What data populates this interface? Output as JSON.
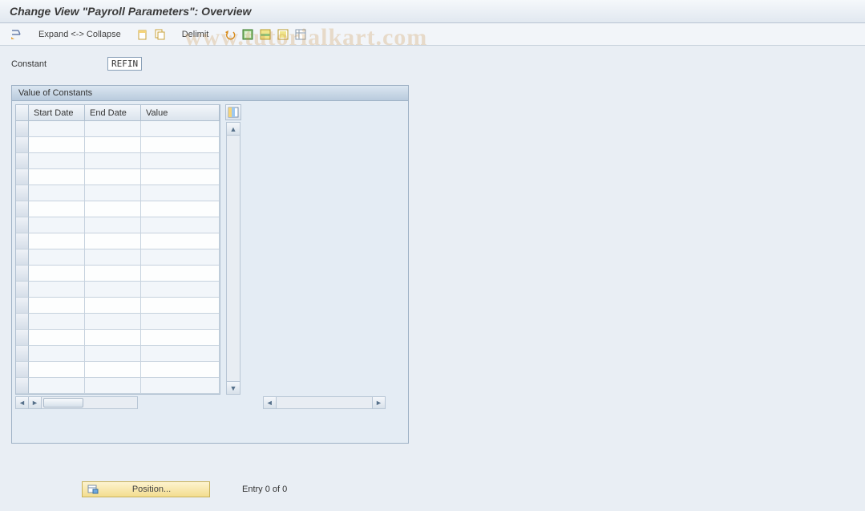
{
  "title": "Change View \"Payroll Parameters\": Overview",
  "watermark": "www.tutorialkart.com",
  "toolbar": {
    "expand_collapse": "Expand <-> Collapse",
    "delimit": "Delimit"
  },
  "field": {
    "constant_label": "Constant",
    "constant_value": "REFIN"
  },
  "panel": {
    "title": "Value of Constants",
    "columns": {
      "start_date": "Start Date",
      "end_date": "End Date",
      "value": "Value"
    },
    "rows": [
      {},
      {},
      {},
      {},
      {},
      {},
      {},
      {},
      {},
      {},
      {},
      {},
      {},
      {},
      {},
      {},
      {}
    ]
  },
  "footer": {
    "position_label": "Position...",
    "entry_text": "Entry 0 of 0"
  }
}
